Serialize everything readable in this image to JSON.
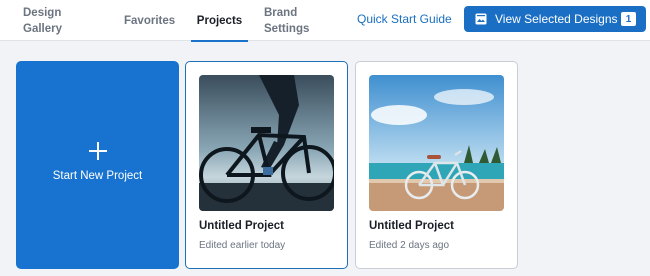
{
  "header": {
    "tabs": [
      {
        "id": "design_gallery",
        "line1": "Design",
        "line2": "Gallery",
        "active": false
      },
      {
        "id": "favorites",
        "label": "Favorites",
        "active": false
      },
      {
        "id": "projects",
        "label": "Projects",
        "active": true
      },
      {
        "id": "brand_settings",
        "line1": "Brand",
        "line2": "Settings",
        "active": false
      }
    ],
    "quick_start_label": "Quick Start Guide",
    "view_selected_label": "View Selected Designs",
    "view_selected_count": "1",
    "colors": {
      "accent": "#1a6fc4",
      "active_underline": "#1a73c8"
    }
  },
  "new_project": {
    "label": "Start New Project",
    "icon": "plus-icon",
    "color": "#1773cf"
  },
  "projects": [
    {
      "title": "Untitled Project",
      "subtitle": "Edited earlier today",
      "selected": true,
      "thumbnail": "bicycle-silhouette-sunset"
    },
    {
      "title": "Untitled Project",
      "subtitle": "Edited 2 days ago",
      "selected": false,
      "thumbnail": "bicycle-beach"
    }
  ]
}
